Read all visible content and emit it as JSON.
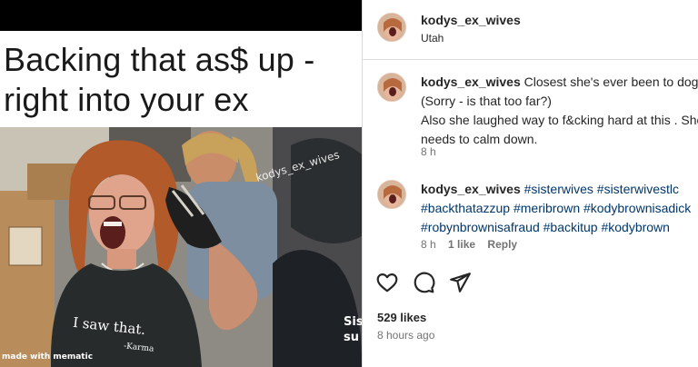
{
  "meme": {
    "caption_line1": "Backing that as$ up -",
    "caption_line2": "right into your ex",
    "shirt_text": "I saw that.",
    "shirt_sub": "-Karma",
    "watermark": "kodys_ex_wives",
    "mematic_credit": "made with mematic",
    "corner_text_1": "Sis",
    "corner_text_2": "su"
  },
  "post": {
    "username": "kodys_ex_wives",
    "location": "Utah"
  },
  "comments": [
    {
      "username": "kodys_ex_wives",
      "lines": [
        "Closest she's ever been to doggy.",
        "(Sorry - is that too far?)",
        "Also she laughed way to f&cking hard at this . She",
        "needs to calm down."
      ],
      "time": "8 h"
    },
    {
      "username": "kodys_ex_wives",
      "hashtags": [
        "#sisterwives",
        "#sisterwivestlc",
        "#backthatazzup",
        "#meribrown",
        "#kodybrownisadick",
        "#robynbrownisafraud",
        "#backitup",
        "#kodybrown"
      ],
      "time": "8 h",
      "likes": "1 like",
      "reply_label": "Reply"
    }
  ],
  "actions": [
    "heart-icon",
    "comment-icon",
    "share-icon"
  ],
  "likes_count": "529 likes",
  "posted_time": "8 hours ago",
  "colors": {
    "hashtag": "#00376b",
    "border": "#dbdbdb",
    "muted": "#737373"
  }
}
